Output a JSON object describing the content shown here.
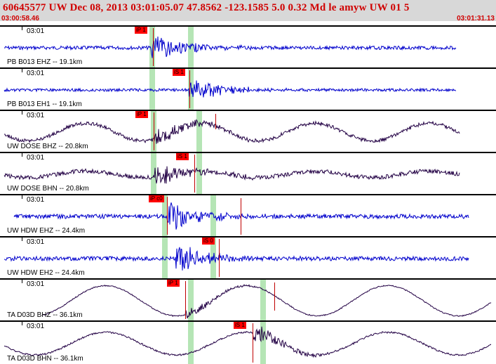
{
  "header": {
    "title": "60645577 UW Dec 08, 2013 03:01:05.07    47.8562 -123.1585  5.0 0.32 Md le amyw UW 01    5",
    "time_start": "03:00:58.46",
    "time_end": "03:01:31.13"
  },
  "channels": [
    {
      "label": "PB B013 EHZ -- 19.1km",
      "time": "03:01",
      "pick": "iP 1",
      "color": "#0000cc"
    },
    {
      "label": "PB B013 EH1 -- 19.1km",
      "time": "03:01",
      "pick": "iS 1",
      "color": "#0000cc"
    },
    {
      "label": "UW DOSE BHZ -- 20.8km",
      "time": "03:01",
      "pick": "iP 1",
      "color": "#220044"
    },
    {
      "label": "UW DOSE BHN -- 20.8km",
      "time": "03:01",
      "pick": "iS 1",
      "color": "#220044"
    },
    {
      "label": "UW HDW EHZ -- 24.4km",
      "time": "03:01",
      "pick": "iP c0",
      "color": "#0000cc"
    },
    {
      "label": "UW HDW EH2 -- 24.4km",
      "time": "03:01",
      "pick": "iS 0",
      "color": "#0000cc"
    },
    {
      "label": "TA D03D BHZ -- 36.1km",
      "time": "03:01",
      "pick": "iP 1",
      "color": "#220044"
    },
    {
      "label": "TA D03D BHN -- 36.1km",
      "time": "03:01",
      "pick": "iS 1",
      "color": "#220044"
    }
  ]
}
